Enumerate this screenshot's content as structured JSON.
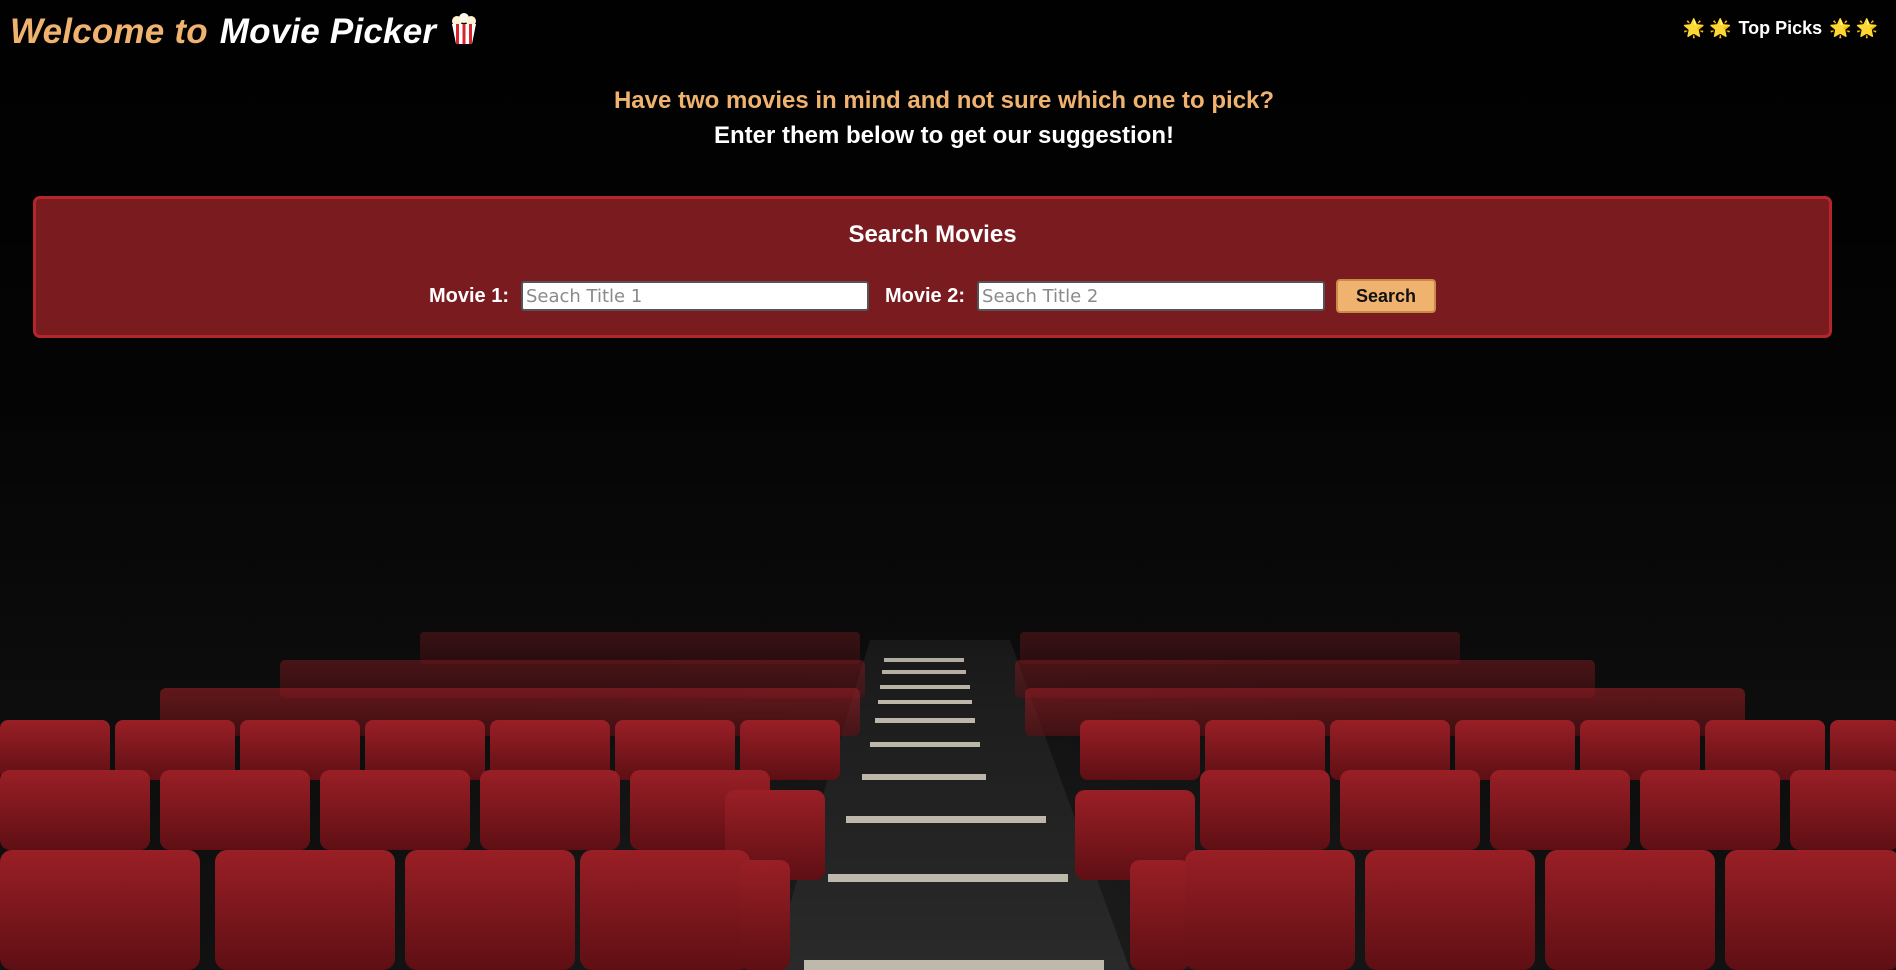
{
  "header": {
    "welcome_text": "Welcome to",
    "app_name": "Movie Picker",
    "brand_icon": "popcorn-icon",
    "top_picks": {
      "label": "Top Picks",
      "icon": "star-icon",
      "star_glyph": "🌟"
    }
  },
  "intro": {
    "question": "Have two movies in mind and not sure which one to pick?",
    "instruction": "Enter them below to get our suggestion!"
  },
  "search": {
    "title": "Search Movies",
    "movie1_label": "Movie 1:",
    "movie1_placeholder": "Seach Title 1",
    "movie1_value": "",
    "movie2_label": "Movie 2:",
    "movie2_placeholder": "Seach Title 2",
    "movie2_value": "",
    "button_label": "Search"
  },
  "colors": {
    "accent": "#f0b26f",
    "panel_background": "#7a1b20",
    "panel_border": "#b5262b",
    "text": "#ffffff",
    "page_background": "#060606"
  },
  "background": {
    "scene": "cinema-seats-image"
  }
}
